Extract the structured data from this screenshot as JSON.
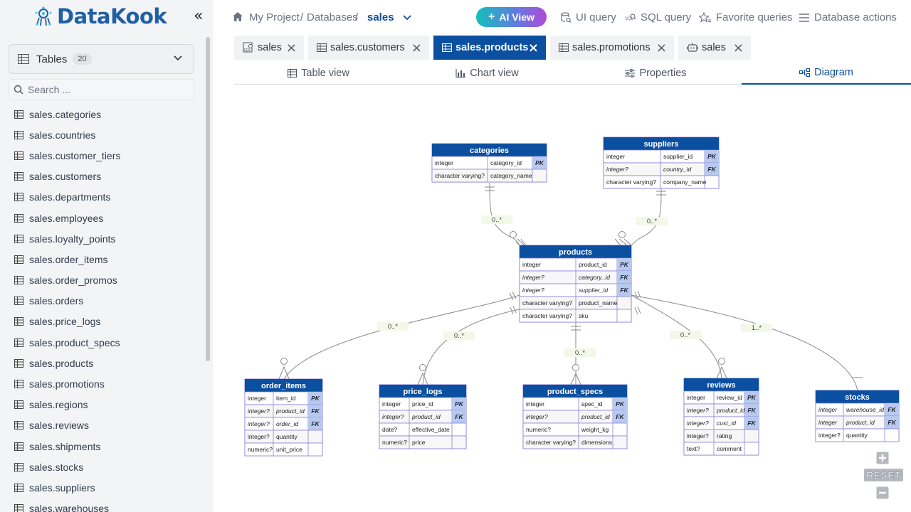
{
  "app": {
    "name": "DataKook"
  },
  "sidebar": {
    "tables_label": "Tables",
    "tables_count": "20",
    "search_placeholder": "Search ...",
    "tables": [
      "sales.categories",
      "sales.countries",
      "sales.customer_tiers",
      "sales.customers",
      "sales.departments",
      "sales.employees",
      "sales.loyalty_points",
      "sales.order_items",
      "sales.order_promos",
      "sales.orders",
      "sales.price_logs",
      "sales.product_specs",
      "sales.products",
      "sales.promotions",
      "sales.regions",
      "sales.reviews",
      "sales.shipments",
      "sales.stocks",
      "sales.suppliers",
      "sales.warehouses"
    ]
  },
  "breadcrumb": {
    "project": "My Project",
    "sep1": "/",
    "databases": "Databases",
    "sep2": "/",
    "current": "sales"
  },
  "toolbar": {
    "ai_view": "AI View",
    "ui_query": "UI query",
    "sql_query": "SQL query",
    "favorites": "Favorite queries",
    "db_actions": "Database actions"
  },
  "tabs": [
    {
      "label": "sales",
      "icon": "sql-icon"
    },
    {
      "label": "sales.customers",
      "icon": "table-icon"
    },
    {
      "label": "sales.products",
      "icon": "table-icon",
      "active": true
    },
    {
      "label": "sales.promotions",
      "icon": "table-icon"
    },
    {
      "label": "sales",
      "icon": "robot-icon"
    }
  ],
  "view_tabs": {
    "table": "Table view",
    "chart": "Chart view",
    "properties": "Properties",
    "diagram": "Diagram"
  },
  "diagram": {
    "colors": {
      "header": "#0b4fa1",
      "border": "#8b7fd8",
      "key": "#b7c9ef",
      "line": "#8a8a8a"
    },
    "entities": [
      {
        "name": "categories",
        "rows": [
          [
            "integer",
            "category_id",
            "PK"
          ],
          [
            "character varying?",
            "category_name",
            ""
          ]
        ]
      },
      {
        "name": "suppliers",
        "rows": [
          [
            "integer",
            "supplier_id",
            "PK"
          ],
          [
            "integer?",
            "country_id",
            "FK"
          ],
          [
            "character varying?",
            "company_name",
            ""
          ]
        ]
      },
      {
        "name": "products",
        "rows": [
          [
            "integer",
            "product_id",
            "PK"
          ],
          [
            "integer?",
            "category_id",
            "FK"
          ],
          [
            "integer?",
            "supplier_id",
            "FK"
          ],
          [
            "character varying?",
            "product_name",
            ""
          ],
          [
            "character varying?",
            "sku",
            ""
          ]
        ]
      },
      {
        "name": "order_items",
        "rows": [
          [
            "integer",
            "item_id",
            "PK"
          ],
          [
            "integer?",
            "product_id",
            "FK"
          ],
          [
            "integer?",
            "order_id",
            "FK"
          ],
          [
            "integer?",
            "quantity",
            ""
          ],
          [
            "numeric?",
            "unit_price",
            ""
          ]
        ]
      },
      {
        "name": "price_logs",
        "rows": [
          [
            "integer",
            "price_id",
            "PK"
          ],
          [
            "integer?",
            "product_id",
            "FK"
          ],
          [
            "date?",
            "effective_date",
            ""
          ],
          [
            "numeric?",
            "price",
            ""
          ]
        ]
      },
      {
        "name": "product_specs",
        "rows": [
          [
            "integer",
            "spec_id",
            "PK"
          ],
          [
            "integer?",
            "product_id",
            "FK"
          ],
          [
            "numeric?",
            "weight_kg",
            ""
          ],
          [
            "character varying?",
            "dimensions",
            ""
          ]
        ]
      },
      {
        "name": "reviews",
        "rows": [
          [
            "integer",
            "review_id",
            "PK"
          ],
          [
            "integer?",
            "product_id",
            "FK"
          ],
          [
            "integer?",
            "cust_id",
            "FK"
          ],
          [
            "integer?",
            "rating",
            ""
          ],
          [
            "text?",
            "comment",
            ""
          ]
        ]
      },
      {
        "name": "stocks",
        "rows": [
          [
            "integer",
            "warehouse_id",
            "FK"
          ],
          [
            "integer",
            "product_id",
            "FK"
          ],
          [
            "integer?",
            "quantity",
            ""
          ]
        ]
      }
    ],
    "cardinalities": [
      "0..*",
      "0..*",
      "0..*",
      "0..*",
      "0..*",
      "0..*",
      "1..*"
    ]
  },
  "zoom": {
    "reset": "RESET"
  }
}
